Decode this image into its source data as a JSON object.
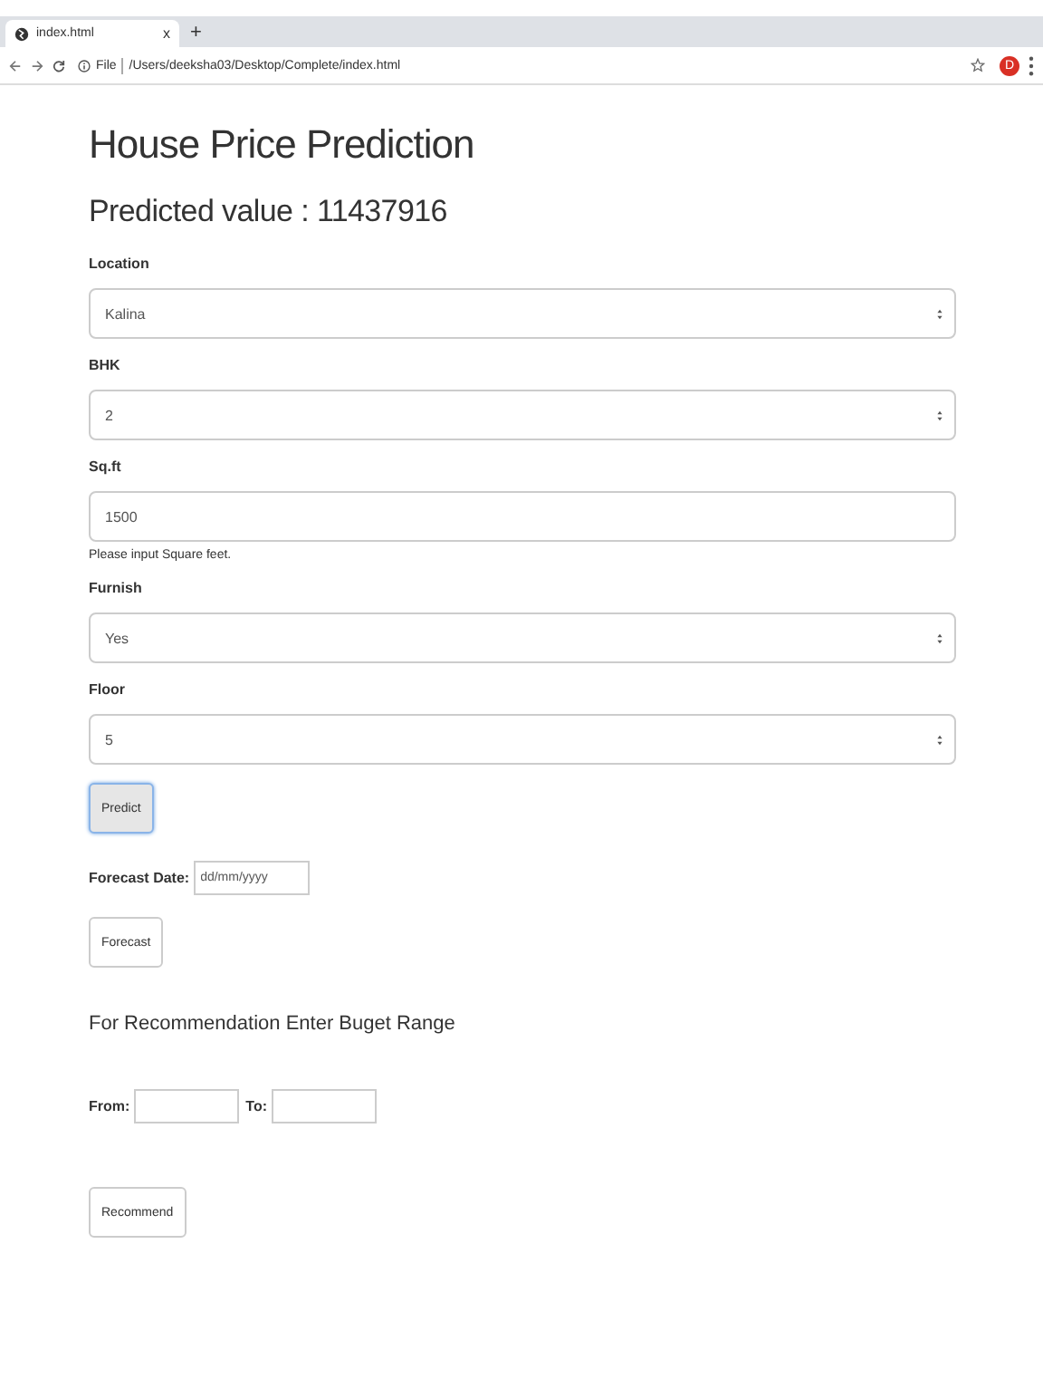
{
  "browser": {
    "tab": {
      "title": "index.html",
      "close": "x"
    },
    "new_tab": "+",
    "address": {
      "scheme": "File",
      "path": "/Users/deeksha03/Desktop/Complete/index.html"
    },
    "avatar": "D"
  },
  "page": {
    "title": "House Price Prediction",
    "result": "Predicted value : 11437916",
    "fields": [
      {
        "kind": "select",
        "label": "Location",
        "value": "Kalina"
      },
      {
        "kind": "select",
        "label": "BHK",
        "value": "2"
      },
      {
        "kind": "input",
        "label": "Sq.ft",
        "value": "1500",
        "help": "Please input Square feet."
      },
      {
        "kind": "select",
        "label": "Furnish",
        "value": "Yes"
      },
      {
        "kind": "select",
        "label": "Floor",
        "value": "5"
      }
    ],
    "predict_button": "Predict",
    "forecast": {
      "label": "Forecast Date:",
      "placeholder": "dd/mm/yyyy",
      "button": "Forecast"
    },
    "recommendation": {
      "heading": "For Recommendation Enter Buget Range",
      "from_label": "From:",
      "to_label": "To:",
      "button": "Recommend"
    }
  }
}
